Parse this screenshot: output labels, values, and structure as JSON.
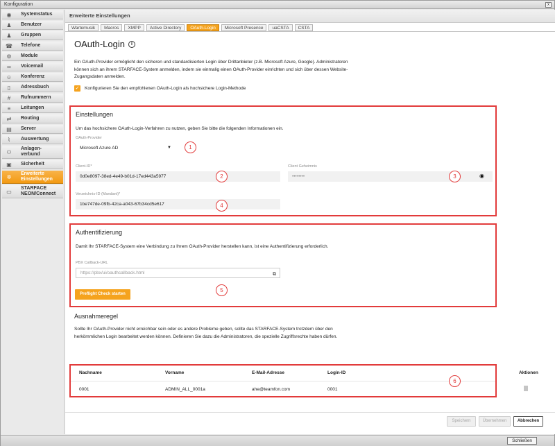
{
  "window": {
    "title": "Konfiguration",
    "close_glyph": "x"
  },
  "sidebar": {
    "items": [
      {
        "icon": "◉",
        "label": "Systemstatus"
      },
      {
        "icon": "♟",
        "label": "Benutzer"
      },
      {
        "icon": "♟",
        "label": "Gruppen"
      },
      {
        "icon": "☎",
        "label": "Telefone"
      },
      {
        "icon": "⚙",
        "label": "Module"
      },
      {
        "icon": "∞",
        "label": "Voicemail"
      },
      {
        "icon": "☺",
        "label": "Konferenz"
      },
      {
        "icon": "▯",
        "label": "Adressbuch"
      },
      {
        "icon": "#",
        "label": "Rufnummern"
      },
      {
        "icon": "≡",
        "label": "Leitungen"
      },
      {
        "icon": "⇄",
        "label": "Routing"
      },
      {
        "icon": "▤",
        "label": "Server"
      },
      {
        "icon": "⌇",
        "label": "Auswertung"
      },
      {
        "icon": "⚇",
        "label": "Anlagen-verbund"
      },
      {
        "icon": "▣",
        "label": "Sicherheit"
      },
      {
        "icon": "✲",
        "label": "Erweiterte Einstellungen"
      },
      {
        "icon": "▭",
        "label": "STARFACE NEON/Connect"
      }
    ]
  },
  "main": {
    "header": "Erweiterte Einstellungen",
    "tabs": [
      "Wartemusik",
      "Macros",
      "XMPP",
      "Active Directory",
      "OAuth-Login",
      "Microsoft Presence",
      "uaCSTA",
      "CSTA"
    ],
    "page_title": "OAuth-Login",
    "info_glyph": "i",
    "intro": "Ein OAuth-Provider ermöglicht den sicheren und standardisierten Login über Drittanbieter (z.B. Microsoft Azure, Google). Administratoren können sich an ihrem STARFACE-System anmelden, indem sie einmalig einen OAuth-Provider einrichten und sich über dessen Website-Zugangsdaten anmelden.",
    "checkbox_label": "Konfigurieren Sie den empfohlenen OAuth-Login als hochsichere Login-Methode",
    "checkbox_glyph": "✓"
  },
  "settings": {
    "title": "Einstellungen",
    "text": "Um das hochsichere OAuth-Login-Verfahren zu nutzen, geben Sie bitte die folgenden Informationen ein.",
    "provider_label": "OAuth-Provider",
    "provider_value": "Microsoft Azure AD",
    "client_id_label": "Client-ID*",
    "client_id_value": "0d0e8097-38ed-4e49-b01d-17ed443a5977",
    "secret_label": "Client Geheimnis",
    "secret_value": "••••••••",
    "tenant_label": "Verzeichnis-ID (Mandant)*",
    "tenant_value": "1be747de-09fb-42ca-a043-67b34cd5e617"
  },
  "auth": {
    "title": "Authentifizierung",
    "text": "Damit Ihr STARFACE-System eine Verbindung zu Ihrem OAuth-Provider herstellen kann, ist eine Authentifizierung erforderlich.",
    "url_label": "PBX Callback-URL",
    "url_placeholder": "https://pbx/ui/oauthcallback.html",
    "preflight_button": "Preflight Check starten"
  },
  "exceptions": {
    "title": "Ausnahmeregel",
    "text": "Sollte Ihr OAuth-Provider nicht erreichbar sein oder es andere Probleme geben, sollte das STARFACE-System trotzdem über den herkömmlichen Login bearbeitet werden können. Definieren Sie dazu die Administratoren, die spezielle Zugriffsrechte haben dürfen.",
    "columns": [
      "Nachname",
      "Vorname",
      "E-Mail-Adresse",
      "Login-ID",
      "Aktionen"
    ],
    "rows": [
      {
        "lastname": "0001",
        "firstname": "ADMIN_ALL_0001a",
        "email": "ahe@teamfon.com",
        "login": "0001"
      }
    ]
  },
  "markers": [
    "1",
    "2",
    "3",
    "4",
    "5",
    "6"
  ],
  "footer": {
    "save": "Speichern",
    "apply": "Übernehmen",
    "cancel": "Abbrechen",
    "close": "Schließen"
  },
  "colors": {
    "accent": "#f5a31e",
    "highlight": "#e23b3b"
  }
}
